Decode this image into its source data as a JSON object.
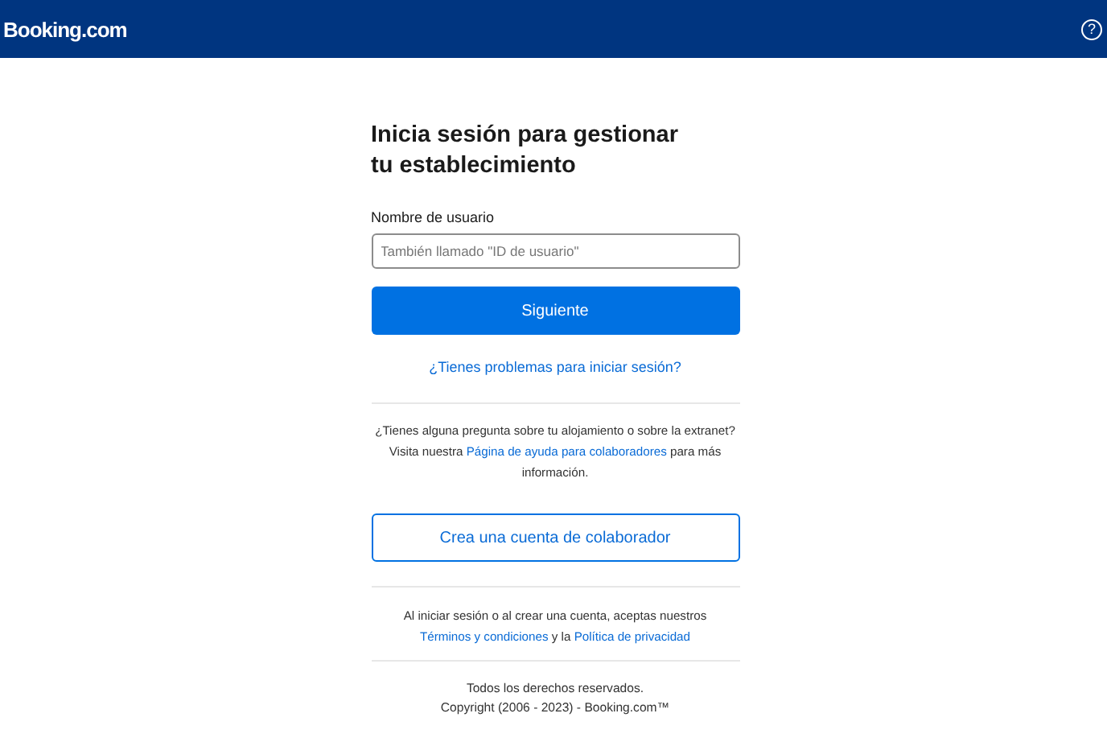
{
  "header": {
    "logo": "Booking.com",
    "help_icon": "?"
  },
  "title": "Inicia sesión para gestionar tu establecimiento",
  "username": {
    "label": "Nombre de usuario",
    "placeholder": "También llamado \"ID de usuario\""
  },
  "next_button": "Siguiente",
  "trouble_link": "¿Tienes problemas para iniciar sesión?",
  "help_text": [
    {
      "kind": "text",
      "text": "¿Tienes alguna pregunta sobre tu alojamiento o sobre la extranet? Visita nuestra "
    },
    {
      "kind": "link",
      "text": "Página de ayuda para colaboradores"
    },
    {
      "kind": "text",
      "text": " para más información."
    }
  ],
  "create_button": "Crea una cuenta de colaborador",
  "terms_text": [
    {
      "kind": "text",
      "text": "Al iniciar sesión o al crear una cuenta, aceptas nuestros "
    },
    {
      "kind": "link",
      "text": "Términos y condiciones"
    },
    {
      "kind": "text",
      "text": " y la "
    },
    {
      "kind": "link",
      "text": "Política de privacidad"
    }
  ],
  "footer": [
    "Todos los derechos reservados.",
    "Copyright (2006 - 2023) - Booking.com™"
  ]
}
